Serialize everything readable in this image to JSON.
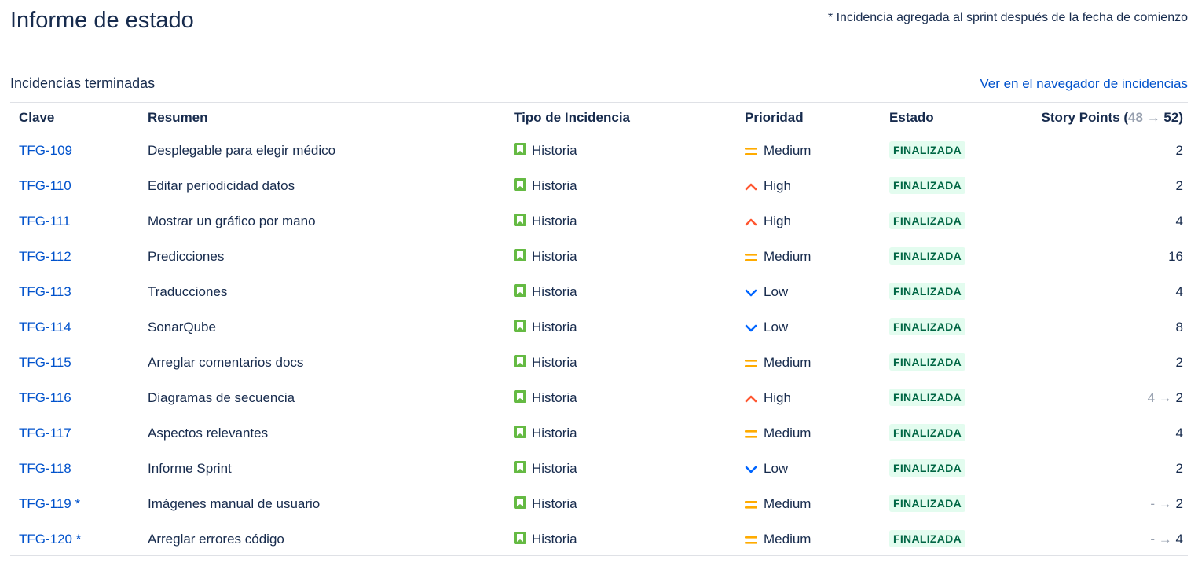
{
  "page_title": "Informe de estado",
  "added_note": "* Incidencia agregada al sprint después de la fecha de comienzo",
  "section": {
    "title": "Incidencias terminadas",
    "nav_link": "Ver en el navegador de incidencias"
  },
  "table": {
    "headers": {
      "key": "Clave",
      "summary": "Resumen",
      "type": "Tipo de Incidencia",
      "priority": "Prioridad",
      "status": "Estado",
      "story_points": "Story Points (",
      "sp_old": "48",
      "sp_arrow": "→",
      "sp_new": "52)"
    },
    "rows": [
      {
        "key": "TFG-109",
        "summary": "Desplegable para elegir médico",
        "type": "Historia",
        "priority": "Medium",
        "status": "FINALIZADA",
        "sp_old": "",
        "sp_new": "2"
      },
      {
        "key": "TFG-110",
        "summary": "Editar periodicidad datos",
        "type": "Historia",
        "priority": "High",
        "status": "FINALIZADA",
        "sp_old": "",
        "sp_new": "2"
      },
      {
        "key": "TFG-111",
        "summary": "Mostrar un gráfico por mano",
        "type": "Historia",
        "priority": "High",
        "status": "FINALIZADA",
        "sp_old": "",
        "sp_new": "4"
      },
      {
        "key": "TFG-112",
        "summary": "Predicciones",
        "type": "Historia",
        "priority": "Medium",
        "status": "FINALIZADA",
        "sp_old": "",
        "sp_new": "16"
      },
      {
        "key": "TFG-113",
        "summary": "Traducciones",
        "type": "Historia",
        "priority": "Low",
        "status": "FINALIZADA",
        "sp_old": "",
        "sp_new": "4"
      },
      {
        "key": "TFG-114",
        "summary": "SonarQube",
        "type": "Historia",
        "priority": "Low",
        "status": "FINALIZADA",
        "sp_old": "",
        "sp_new": "8"
      },
      {
        "key": "TFG-115",
        "summary": "Arreglar comentarios docs",
        "type": "Historia",
        "priority": "Medium",
        "status": "FINALIZADA",
        "sp_old": "",
        "sp_new": "2"
      },
      {
        "key": "TFG-116",
        "summary": "Diagramas de secuencia",
        "type": "Historia",
        "priority": "High",
        "status": "FINALIZADA",
        "sp_old": "4",
        "sp_new": "2"
      },
      {
        "key": "TFG-117",
        "summary": "Aspectos relevantes",
        "type": "Historia",
        "priority": "Medium",
        "status": "FINALIZADA",
        "sp_old": "",
        "sp_new": "4"
      },
      {
        "key": "TFG-118",
        "summary": "Informe Sprint",
        "type": "Historia",
        "priority": "Low",
        "status": "FINALIZADA",
        "sp_old": "",
        "sp_new": "2"
      },
      {
        "key": "TFG-119 *",
        "summary": "Imágenes manual de usuario",
        "type": "Historia",
        "priority": "Medium",
        "status": "FINALIZADA",
        "sp_old": "-",
        "sp_new": "2"
      },
      {
        "key": "TFG-120 *",
        "summary": "Arreglar errores código",
        "type": "Historia",
        "priority": "Medium",
        "status": "FINALIZADA",
        "sp_old": "-",
        "sp_new": "4"
      }
    ]
  },
  "icons": {
    "type_icon": "story-bookmark-icon",
    "priority_icons": {
      "Medium": "priority-medium-icon",
      "High": "priority-high-icon",
      "Low": "priority-low-icon"
    }
  },
  "colors": {
    "link": "#0052cc",
    "story_green": "#65ba43",
    "priority_medium": "#ffab00",
    "priority_high": "#ff5630",
    "priority_low": "#0065ff",
    "status_bg": "#e3fcef",
    "status_text": "#006644"
  }
}
